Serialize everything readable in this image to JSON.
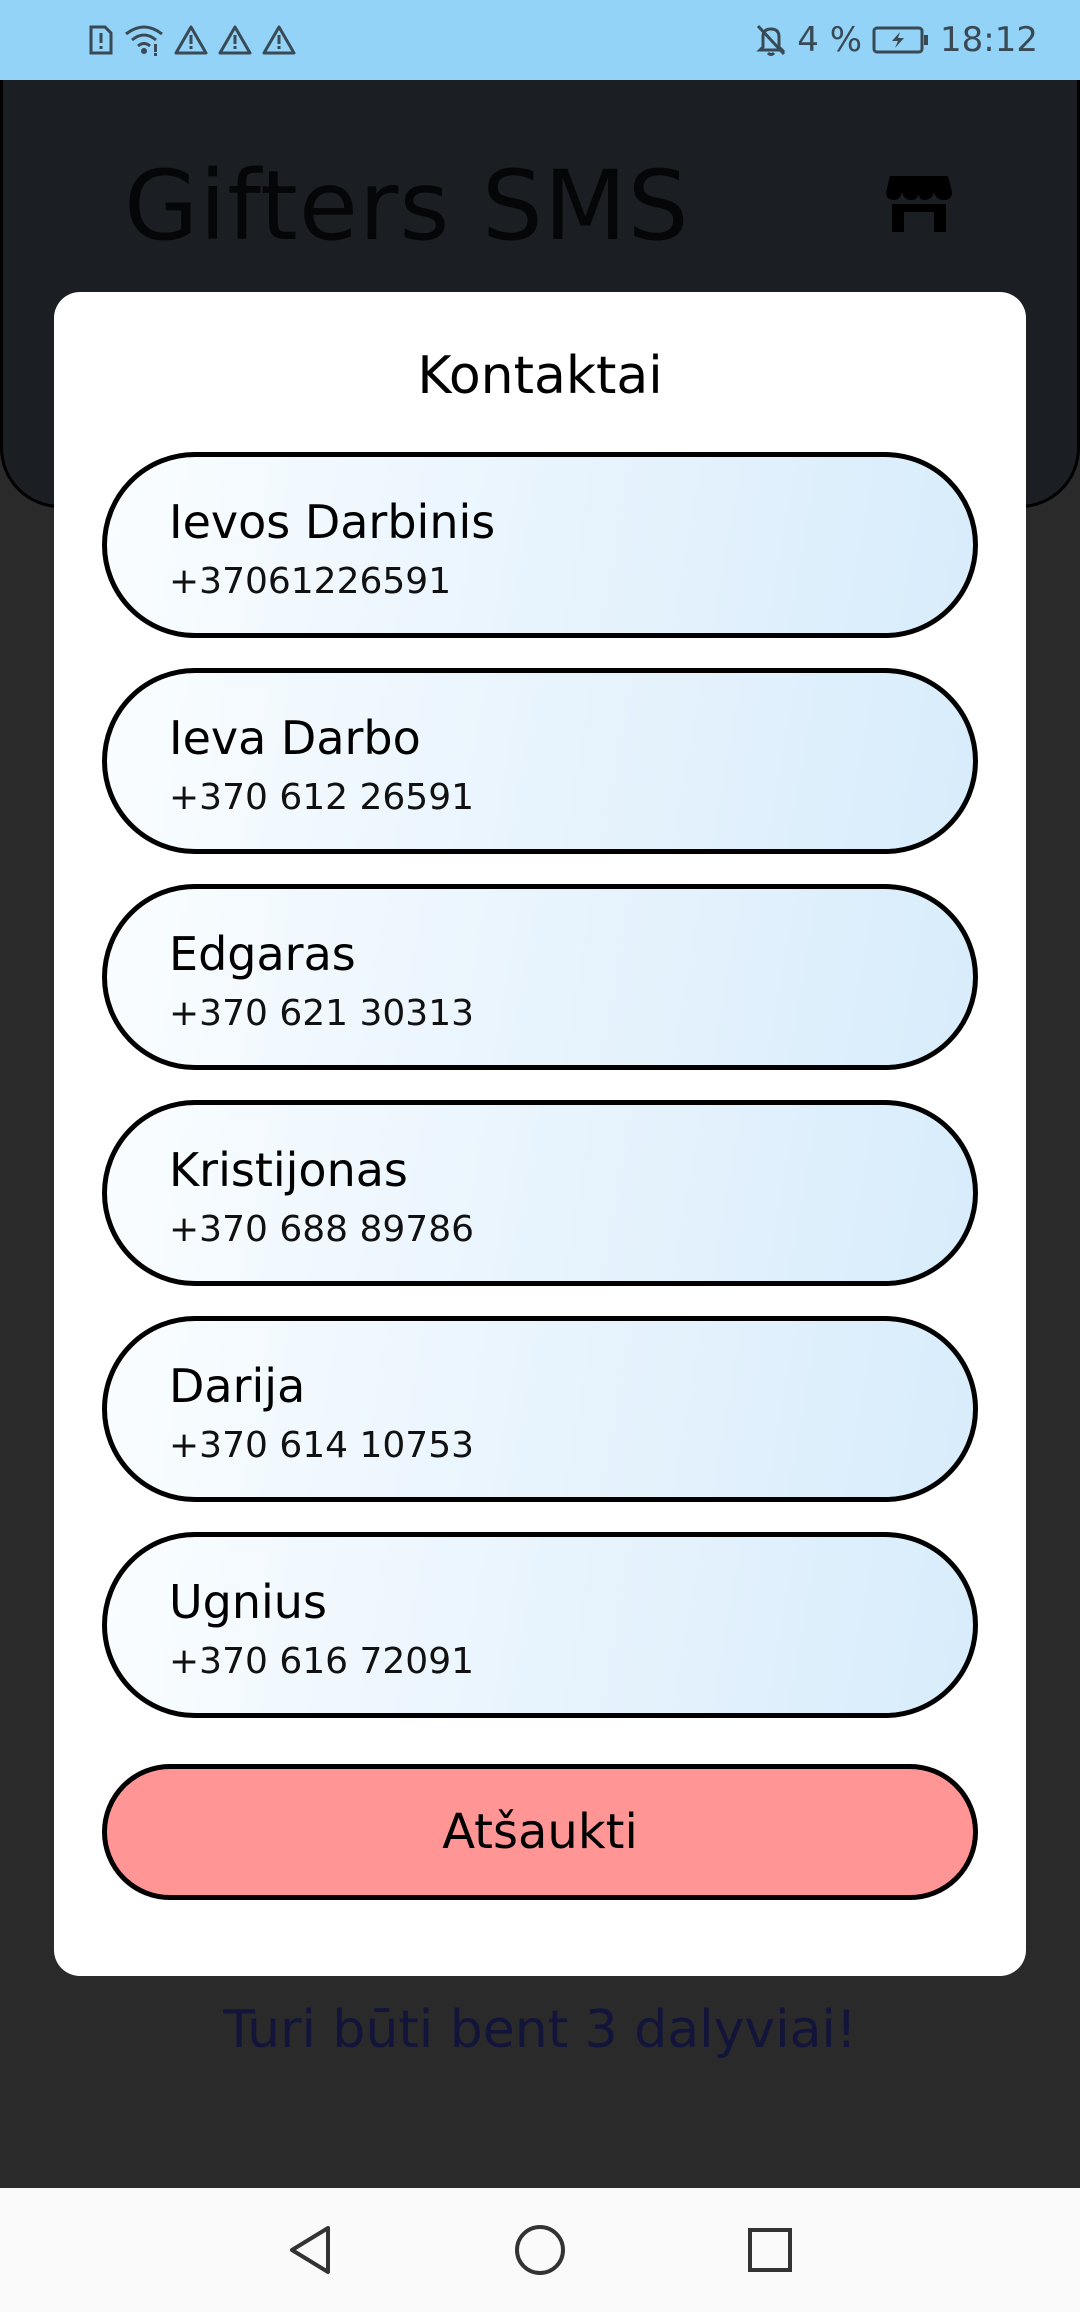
{
  "status_bar": {
    "battery_percent": "4 %",
    "time": "18:12"
  },
  "app": {
    "title": "Gifters SMS",
    "warning": "Turi būti bent 3 dalyviai!"
  },
  "dialog": {
    "title": "Kontaktai",
    "contacts": [
      {
        "name": "Ievos Darbinis",
        "phone": "+37061226591"
      },
      {
        "name": "Ieva Darbo",
        "phone": "+370 612 26591"
      },
      {
        "name": "Edgaras",
        "phone": "+370 621 30313"
      },
      {
        "name": "Kristijonas",
        "phone": "+370 688 89786"
      },
      {
        "name": "Darija",
        "phone": "+370 614 10753"
      },
      {
        "name": "Ugnius",
        "phone": "+370 616 72091"
      }
    ],
    "cancel_label": "Atšaukti"
  },
  "colors": {
    "status_bar": "#93d3f8",
    "cancel": "#ff9595",
    "contact_gradient_end": "#d8ecfb"
  },
  "icons": {
    "status_left": [
      "sim-alert-icon",
      "wifi-icon",
      "warning-icon",
      "warning-icon",
      "warning-icon"
    ],
    "status_right": [
      "bell-off-icon",
      "battery-charging-icon"
    ],
    "app": [
      "store-icon"
    ],
    "nav": [
      "back-icon",
      "home-icon",
      "recents-icon"
    ]
  }
}
